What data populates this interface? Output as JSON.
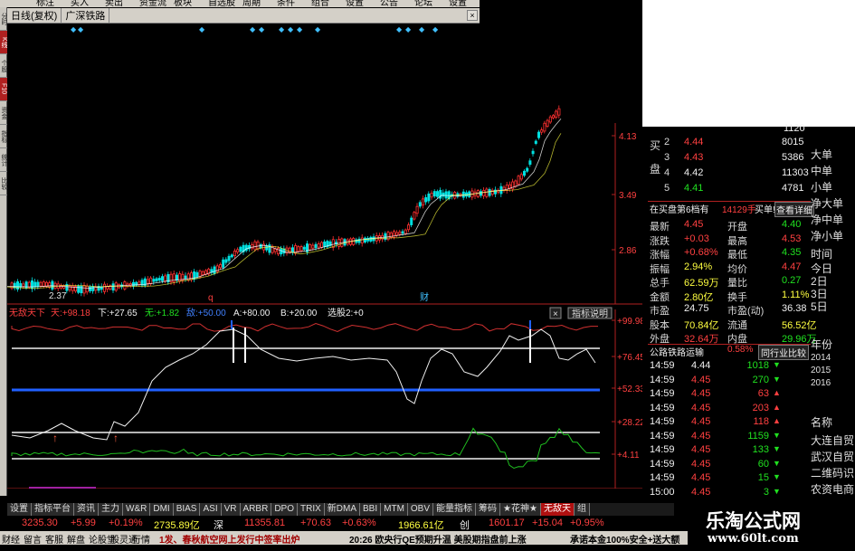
{
  "window": {
    "title_tab": "日线(复权)",
    "stock_name": "广深铁路",
    "menu_items": [
      "标注",
      "买入",
      "卖出",
      "资金流",
      "板块",
      "自选股",
      "周期",
      "条件",
      "组合",
      "设置",
      "公告",
      "论坛",
      "设置"
    ],
    "close_button": "×"
  },
  "left_strip": [
    "分时",
    "K线",
    "个股",
    "F10",
    "资金",
    "指标",
    "统计",
    "比较"
  ],
  "main_chart": {
    "price_ticks": [
      "4.13",
      "3.49",
      "2.86"
    ],
    "low_label": "2.37",
    "event_markers": [
      "q",
      "财"
    ]
  },
  "indicator": {
    "name": "无敌天下",
    "legend": [
      {
        "label": "天:",
        "value": "+98.18",
        "color": "#ff4040"
      },
      {
        "label": "下:",
        "value": "+27.65",
        "color": "#f0f0f0"
      },
      {
        "label": "无:",
        "value": "+1.82",
        "color": "#20e020"
      },
      {
        "label": "敌:",
        "value": "+50.00",
        "color": "#4080ff"
      },
      {
        "label": "A:",
        "value": "+80.00",
        "color": "#f0f0f0"
      },
      {
        "label": "B:",
        "value": "+20.00",
        "color": "#f0f0f0"
      },
      {
        "label": "选股2:",
        "value": "+0",
        "color": "#f0f0f0"
      }
    ],
    "buttons": [
      "×",
      "指标说明"
    ],
    "ticks": [
      "+99.98",
      "+76.45",
      "+52.33",
      "+28.22",
      "+4.11"
    ]
  },
  "date_axis": {
    "labels": [
      "05",
      "06",
      "07",
      "08",
      "09",
      "10",
      "11",
      "12",
      "01"
    ],
    "cursor_date": "2014-05-13/二"
  },
  "order_book": {
    "side_label": "买盘",
    "bids": [
      {
        "level": "2",
        "price": "4.44",
        "volume": "8015"
      },
      {
        "level": "3",
        "price": "4.43",
        "volume": "5386"
      },
      {
        "level": "4",
        "price": "4.42",
        "volume": "11303"
      },
      {
        "level": "5",
        "price": "4.41",
        "volume": "4781"
      }
    ],
    "top_volume": "1120"
  },
  "bid_summary": {
    "text": "在买盘第6档有",
    "volume": "14129手",
    "action": "买单!",
    "detail_button": "查看详细"
  },
  "quote": {
    "rows": [
      {
        "l1": "最新",
        "v1": "4.45",
        "c1": "red",
        "l2": "开盘",
        "v2": "4.40",
        "c2": "grn"
      },
      {
        "l1": "涨跌",
        "v1": "+0.03",
        "c1": "red",
        "l2": "最高",
        "v2": "4.53",
        "c2": "red"
      },
      {
        "l1": "涨幅",
        "v1": "+0.68%",
        "c1": "red",
        "l2": "最低",
        "v2": "4.35",
        "c2": "grn"
      },
      {
        "l1": "振幅",
        "v1": "2.94%",
        "c1": "yel",
        "l2": "均价",
        "v2": "4.47",
        "c2": "red"
      },
      {
        "l1": "总手",
        "v1": "62.59万",
        "c1": "yel",
        "l2": "量比",
        "v2": "0.27",
        "c2": "grn"
      },
      {
        "l1": "金额",
        "v1": "2.80亿",
        "c1": "yel",
        "l2": "换手",
        "v2": "1.11%",
        "c2": "yel"
      },
      {
        "l1": "市盈",
        "v1": "24.75",
        "c1": "wht",
        "l2": "市盈(动)",
        "v2": "36.38",
        "c2": "wht"
      },
      {
        "l1": "股本",
        "v1": "70.84亿",
        "c1": "yel",
        "l2": "流通",
        "v2": "56.52亿",
        "c2": "yel"
      },
      {
        "l1": "外盘",
        "v1": "32.64万",
        "c1": "red",
        "l2": "内盘",
        "v2": "29.96万",
        "c2": "grn"
      }
    ]
  },
  "sector": {
    "name": "公路铁路运输",
    "change": "0.58%",
    "button": "同行业比较"
  },
  "ticks": [
    {
      "time": "14:59",
      "price": "4.44",
      "vol": "1018",
      "dir": "down"
    },
    {
      "time": "14:59",
      "price": "4.45",
      "vol": "270",
      "dir": "down"
    },
    {
      "time": "14:59",
      "price": "4.45",
      "vol": "63",
      "dir": "up"
    },
    {
      "time": "14:59",
      "price": "4.45",
      "vol": "203",
      "dir": "up"
    },
    {
      "time": "14:59",
      "price": "4.45",
      "vol": "118",
      "dir": "up"
    },
    {
      "time": "14:59",
      "price": "4.45",
      "vol": "1159",
      "dir": "down"
    },
    {
      "time": "14:59",
      "price": "4.45",
      "vol": "133",
      "dir": "down"
    },
    {
      "time": "14:59",
      "price": "4.45",
      "vol": "60",
      "dir": "down"
    },
    {
      "time": "14:59",
      "price": "4.45",
      "vol": "15",
      "dir": "down"
    },
    {
      "time": "15:00",
      "price": "4.45",
      "vol": "3",
      "dir": "down"
    }
  ],
  "far_panel": {
    "flow_items": [
      "大单",
      "中单",
      "小单",
      "净大单",
      "净中单",
      "净小单"
    ],
    "periods": [
      "时间",
      "今日",
      "2日",
      "3日",
      "5日"
    ],
    "years_title": "年份",
    "years": [
      "2014",
      "2015",
      "2016"
    ],
    "names_title": "名称",
    "names": [
      "大连自贸",
      "武汉自贸",
      "二维码识",
      "农资电商"
    ]
  },
  "tabs": [
    "设置",
    "指标平台",
    "资讯",
    "主力",
    "W&R",
    "DMI",
    "BIAS",
    "ASI",
    "VR",
    "ARBR",
    "DPO",
    "TRIX",
    "新DMA",
    "BBI",
    "MTM",
    "OBV",
    "能量指标",
    "筹码",
    "★花神★",
    "无敌天",
    "组"
  ],
  "active_tab": "无敌天",
  "index_bar": [
    {
      "text": "3235.30",
      "color": "#ff4040"
    },
    {
      "text": "+5.99",
      "color": "#ff4040"
    },
    {
      "text": "+0.19%",
      "color": "#ff4040"
    },
    {
      "text": "2735.89亿",
      "color": "#ffff40"
    },
    {
      "text": "深",
      "color": "#f0f0f0"
    },
    {
      "text": "11355.81",
      "color": "#ff4040"
    },
    {
      "text": "+70.63",
      "color": "#ff4040"
    },
    {
      "text": "+0.63%",
      "color": "#ff4040"
    },
    {
      "text": "1966.61亿",
      "color": "#ffff40"
    },
    {
      "text": "创",
      "color": "#f0f0f0"
    },
    {
      "text": "1601.17",
      "color": "#ff4040"
    },
    {
      "text": "+15.04",
      "color": "#ff4040"
    },
    {
      "text": "+0.95%",
      "color": "#ff4040"
    }
  ],
  "news_bar": {
    "items": [
      "财经",
      "留言",
      "客服",
      "解盘",
      "论股堂",
      "股灵通",
      "行情"
    ],
    "headline1": "1发、春秋航空网上发行中签率出炉",
    "headline2": "20:26 欧央行QE预期升温 美股期指盘前上涨",
    "headline3": "承诺本金100%安全+送大额"
  },
  "watermark": {
    "title": "乐淘公式网",
    "url": "www.60lt.com"
  },
  "colors": {
    "up": "#ff3030",
    "down": "#00e0e0",
    "indicator_white": "#f0f0f0",
    "indicator_red": "#d03030",
    "indicator_green": "#20c020",
    "indicator_blue": "#2060ff",
    "axis": "#b02020"
  }
}
